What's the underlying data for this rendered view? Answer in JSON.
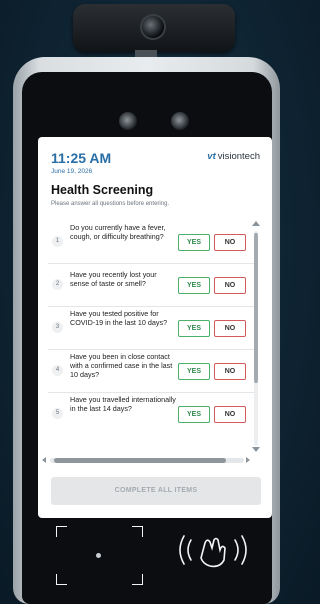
{
  "header": {
    "time": "11:25 AM",
    "date": "June 19, 2026",
    "brand_prefix": "vt",
    "brand_name": "visiontech"
  },
  "screening": {
    "title": "Health Screening",
    "subtitle": "Please answer all questions before entering.",
    "questions": [
      {
        "number": "1",
        "text": "Do you currently have a fever, cough, or difficulty breathing?",
        "yes": "YES",
        "no": "NO"
      },
      {
        "number": "2",
        "text": "Have you recently lost your sense of taste or smell?",
        "yes": "YES",
        "no": "NO"
      },
      {
        "number": "3",
        "text": "Have you tested positive for COVID-19 in the last 10 days?",
        "yes": "YES",
        "no": "NO"
      },
      {
        "number": "4",
        "text": "Have you been in close contact with a confirmed case in the last 10 days?",
        "yes": "YES",
        "no": "NO"
      },
      {
        "number": "5",
        "text": "Have you travelled internationally in the last 14 days?",
        "yes": "YES",
        "no": "NO"
      }
    ],
    "complete_label": "COMPLETE ALL ITEMS"
  },
  "colors": {
    "accent": "#2a6ea6",
    "yes_border": "#4caf6a",
    "no_border": "#d25a5a",
    "disabled_button": "#e4e6e8"
  },
  "icons": [
    "camera-lens-icon",
    "face-frame-icon",
    "nfc-reader-icon",
    "scroll-up-icon",
    "scroll-down-icon",
    "scroll-left-icon",
    "scroll-right-icon"
  ]
}
